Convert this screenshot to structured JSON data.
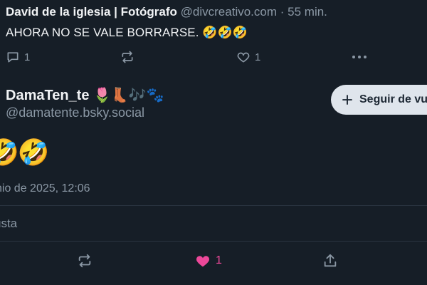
{
  "post": {
    "author": "David de la iglesia | Fotógrafo",
    "handle": "@divcreativo.com",
    "separator": "·",
    "time_ago": "55 min.",
    "text": "AHORA NO SE VALE BORRARSE. 🤣🤣🤣",
    "reply_count": "1",
    "like_count": "1"
  },
  "reply": {
    "display_name": "DamaTen_te 🌷👢🎶🐾",
    "handle": "@damatente.bsky.social",
    "follow_label": "Seguir de vu",
    "content": "🤣🤣",
    "timestamp": "nio de 2025, 12:06",
    "likes_label": "usta",
    "like_count": "1"
  },
  "colors": {
    "background": "#161e27",
    "muted": "#8b98a5",
    "liked": "#ec4899",
    "follow_bg": "#dfe5ec"
  }
}
